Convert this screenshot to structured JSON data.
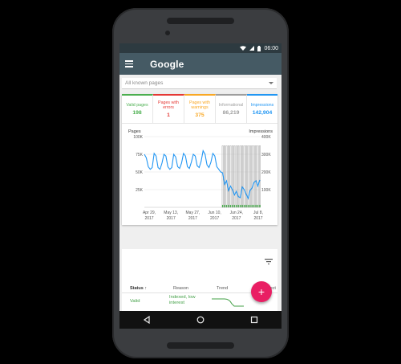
{
  "status_bar": {
    "time": "06:00"
  },
  "app_bar": {
    "title": "Google"
  },
  "filter": {
    "selected": "All known pages"
  },
  "tabs": [
    {
      "label": "Valid pages",
      "count": "198",
      "color": "#4caf50"
    },
    {
      "label": "Pages with errors",
      "count": "1",
      "color": "#e53935"
    },
    {
      "label": "Pages with warnings",
      "count": "375",
      "color": "#f9a825"
    },
    {
      "label": "Informational",
      "count": "86,219",
      "color": "#9e9e9e"
    },
    {
      "label": "Impressions",
      "count": "142,904",
      "color": "#2196f3"
    }
  ],
  "chart_data": {
    "type": "line",
    "left_axis_label": "Pages",
    "right_axis_label": "Impressions",
    "left_ticks": [
      "100K",
      "75K",
      "50K",
      "25K"
    ],
    "right_ticks": [
      "400K",
      "300K",
      "200K",
      "100K"
    ],
    "x_ticks": [
      "Apr 29, 2017",
      "May 13, 2017",
      "May 27, 2017",
      "Jun 10, 2017",
      "Jun 24, 2017",
      "Jul 8, 2017"
    ],
    "ylim_left": [
      0,
      100000
    ],
    "ylim_right": [
      0,
      400000
    ],
    "series": [
      {
        "name": "Impressions",
        "color": "#2196f3",
        "values": [
          300000,
          280000,
          230000,
          215000,
          225000,
          305000,
          290000,
          225000,
          215000,
          250000,
          300000,
          290000,
          230000,
          215000,
          225000,
          300000,
          285000,
          230000,
          220000,
          250000,
          305000,
          290000,
          230000,
          220000,
          255000,
          300000,
          290000,
          235000,
          225000,
          260000,
          320000,
          300000,
          240000,
          225000,
          255000,
          305000,
          290000,
          230000,
          215000,
          200000,
          195000,
          130000,
          150000,
          95000,
          120000,
          100000,
          70000,
          90000,
          60000,
          55000,
          115000,
          100000,
          75000,
          50000,
          95000,
          110000,
          140000,
          150000,
          120000,
          155000
        ]
      },
      {
        "name": "Informational",
        "color": "#9e9e9e",
        "values": [
          0,
          0,
          0,
          0,
          0,
          0,
          0,
          0,
          0,
          0,
          0,
          0,
          0,
          0,
          0,
          0,
          0,
          0,
          0,
          0,
          0,
          0,
          0,
          0,
          0,
          0,
          0,
          0,
          0,
          0,
          0,
          0,
          0,
          0,
          0,
          0,
          0,
          0,
          0,
          0,
          87000,
          87000,
          87000,
          87000,
          87000,
          87000,
          87000,
          87000,
          87000,
          87000,
          87000,
          87000,
          87000,
          87000,
          87000,
          87000,
          87000,
          87000,
          87000,
          87000
        ]
      },
      {
        "name": "Valid",
        "color": "#4caf50",
        "values": [
          0,
          0,
          0,
          0,
          0,
          0,
          0,
          0,
          0,
          0,
          0,
          0,
          0,
          0,
          0,
          0,
          0,
          0,
          0,
          0,
          0,
          0,
          0,
          0,
          0,
          0,
          0,
          0,
          0,
          0,
          0,
          0,
          0,
          0,
          0,
          0,
          0,
          0,
          0,
          0,
          3500,
          3500,
          3500,
          3500,
          3500,
          3500,
          3500,
          3500,
          3500,
          3500,
          3500,
          3500,
          3500,
          3500,
          3500,
          3500,
          3500,
          3500,
          3500,
          3500
        ]
      }
    ]
  },
  "table": {
    "headers": {
      "status": "Status",
      "reason": "Reason",
      "trend": "Trend",
      "affected": "Affect"
    },
    "rows": [
      {
        "status": "Valid",
        "reason": "Indexed, low interest"
      }
    ]
  },
  "fab": {
    "label": "+"
  }
}
